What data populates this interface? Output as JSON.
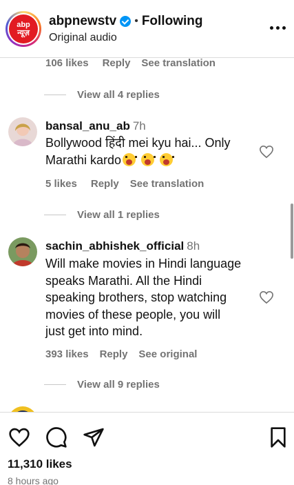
{
  "header": {
    "logo_top": "abp",
    "logo_bottom": "न्यूज़",
    "account": "abpnewstv",
    "separator": "•",
    "following": "Following",
    "audio": "Original audio"
  },
  "comments_prev": {
    "likes": "106 likes",
    "reply": "Reply",
    "translate": "See translation",
    "view_replies": "View all 4 replies"
  },
  "comments": [
    {
      "user": "bansal_anu_ab",
      "time": "7h",
      "line1": "Bollywood हिंदी mei kyu hai... Only",
      "line2": "Marathi kardo",
      "likes": "5 likes",
      "reply": "Reply",
      "translate": "See translation",
      "view_replies": "View all 1 replies"
    },
    {
      "user": "sachin_abhishek_official",
      "time": "8h",
      "line1": "Will make movies in Hindi language",
      "line2": "speaks Marathi. All the Hindi",
      "line3": "speaking brothers, stop watching",
      "line4": "movies of these people, you will",
      "line5": "just get into mind.",
      "likes": "393 likes",
      "reply": "Reply",
      "translate": "See original",
      "view_replies": "View all 9 replies"
    }
  ],
  "footer": {
    "likes": "11,310 likes",
    "ago": "8 hours ago"
  },
  "icons": {
    "heart": "heart-icon",
    "comment": "comment-icon",
    "share": "share-icon",
    "bookmark": "bookmark-icon",
    "more": "more-options-icon"
  },
  "colors": {
    "verified": "#0095f6",
    "brand": "#e21b22",
    "secondary_text": "#737373"
  }
}
